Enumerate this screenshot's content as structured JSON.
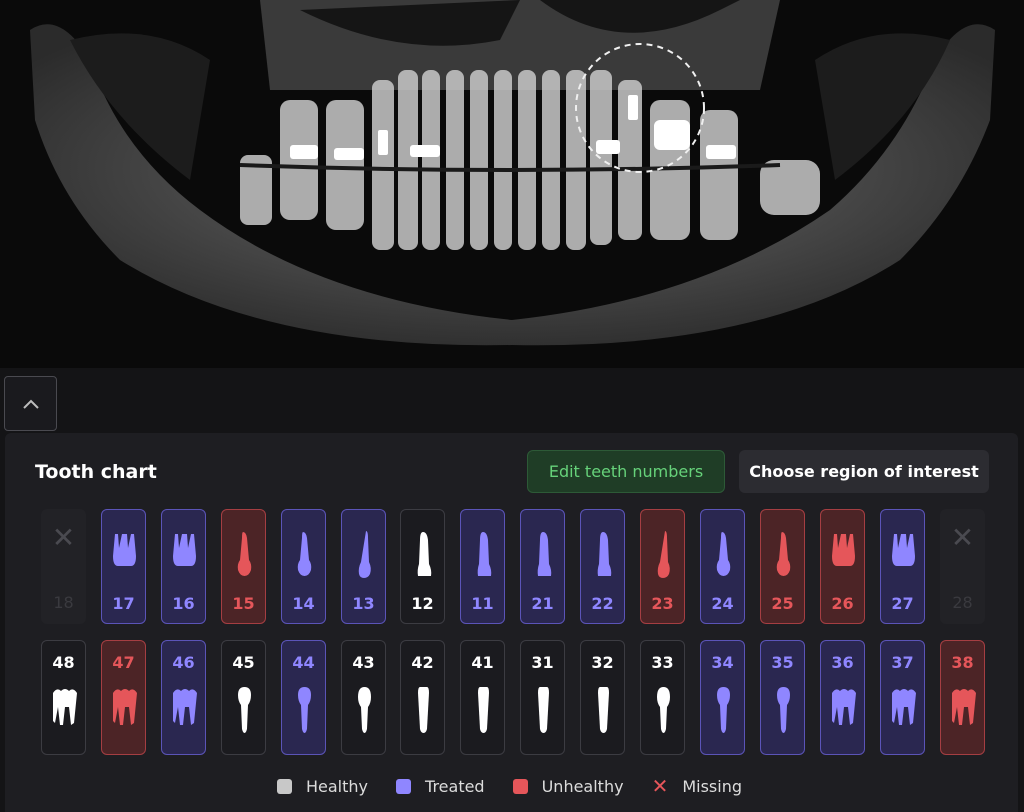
{
  "panel": {
    "title": "Tooth chart",
    "edit_button": "Edit teeth numbers",
    "roi_button": "Choose region of interest"
  },
  "colors": {
    "healthy": "#ffffff",
    "treated": "#8f86ff",
    "unhealthy": "#e5565a",
    "missing": "#4a4a50",
    "edit_button_text": "#66d27a"
  },
  "upper_teeth": [
    {
      "number": "18",
      "status": "missing",
      "type": "molar"
    },
    {
      "number": "17",
      "status": "treated",
      "type": "molar"
    },
    {
      "number": "16",
      "status": "treated",
      "type": "molar"
    },
    {
      "number": "15",
      "status": "unhealthy",
      "type": "premolar"
    },
    {
      "number": "14",
      "status": "treated",
      "type": "premolar"
    },
    {
      "number": "13",
      "status": "treated",
      "type": "canine"
    },
    {
      "number": "12",
      "status": "healthy",
      "type": "incisor"
    },
    {
      "number": "11",
      "status": "treated",
      "type": "incisor"
    },
    {
      "number": "21",
      "status": "treated",
      "type": "incisor"
    },
    {
      "number": "22",
      "status": "treated",
      "type": "incisor"
    },
    {
      "number": "23",
      "status": "unhealthy",
      "type": "canine"
    },
    {
      "number": "24",
      "status": "treated",
      "type": "premolar"
    },
    {
      "number": "25",
      "status": "unhealthy",
      "type": "premolar"
    },
    {
      "number": "26",
      "status": "unhealthy",
      "type": "molar"
    },
    {
      "number": "27",
      "status": "treated",
      "type": "molar"
    },
    {
      "number": "28",
      "status": "missing",
      "type": "molar"
    }
  ],
  "lower_teeth": [
    {
      "number": "48",
      "status": "healthy",
      "type": "molar"
    },
    {
      "number": "47",
      "status": "unhealthy",
      "type": "molar"
    },
    {
      "number": "46",
      "status": "treated",
      "type": "molar"
    },
    {
      "number": "45",
      "status": "healthy",
      "type": "premolar"
    },
    {
      "number": "44",
      "status": "treated",
      "type": "premolar"
    },
    {
      "number": "43",
      "status": "healthy",
      "type": "canine"
    },
    {
      "number": "42",
      "status": "healthy",
      "type": "incisor"
    },
    {
      "number": "41",
      "status": "healthy",
      "type": "incisor"
    },
    {
      "number": "31",
      "status": "healthy",
      "type": "incisor"
    },
    {
      "number": "32",
      "status": "healthy",
      "type": "incisor"
    },
    {
      "number": "33",
      "status": "healthy",
      "type": "canine"
    },
    {
      "number": "34",
      "status": "treated",
      "type": "premolar"
    },
    {
      "number": "35",
      "status": "treated",
      "type": "premolar"
    },
    {
      "number": "36",
      "status": "treated",
      "type": "molar"
    },
    {
      "number": "37",
      "status": "treated",
      "type": "molar"
    },
    {
      "number": "38",
      "status": "unhealthy",
      "type": "molar"
    }
  ],
  "legend": {
    "healthy": "Healthy",
    "treated": "Treated",
    "unhealthy": "Unhealthy",
    "missing": "Missing"
  },
  "icons": {
    "collapse": "chevron-up-icon",
    "missing": "x-icon"
  }
}
